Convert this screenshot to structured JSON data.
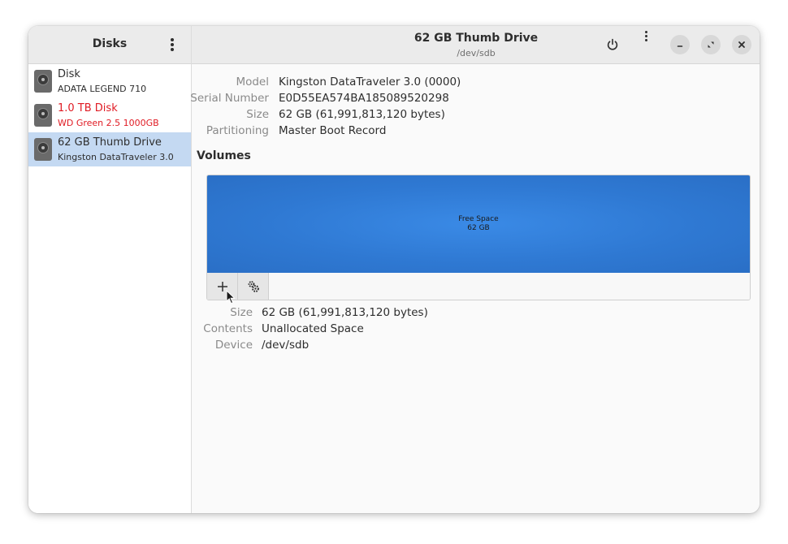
{
  "sidebar": {
    "title": "Disks",
    "disks": [
      {
        "name": "Disk",
        "model": "ADATA LEGEND 710"
      },
      {
        "name": "1.0 TB Disk",
        "model": "WD Green 2.5 1000GB"
      },
      {
        "name": "62 GB Thumb Drive",
        "model": "Kingston DataTraveler 3.0"
      }
    ]
  },
  "header": {
    "title": "62 GB Thumb Drive",
    "subtitle": "/dev/sdb"
  },
  "drive_info": {
    "model_label": "Model",
    "model_value": "Kingston DataTraveler 3.0 (0000)",
    "serial_label": "Serial Number",
    "serial_value": "E0D55EA574BA185089520298",
    "size_label": "Size",
    "size_value": "62 GB (61,991,813,120 bytes)",
    "partitioning_label": "Partitioning",
    "partitioning_value": "Master Boot Record"
  },
  "volumes": {
    "heading": "Volumes",
    "segment_name": "Free Space",
    "segment_size": "62 GB"
  },
  "volume_info": {
    "size_label": "Size",
    "size_value": "62 GB (61,991,813,120 bytes)",
    "contents_label": "Contents",
    "contents_value": "Unallocated Space",
    "device_label": "Device",
    "device_value": "/dev/sdb"
  },
  "colors": {
    "accent_selected": "#c4d9f2",
    "warning": "#e01b24",
    "volume_free_space": "#2f79d3"
  },
  "icons": [
    "disk-icon",
    "kebab-menu-icon",
    "power-icon",
    "minimize-icon",
    "maximize-icon",
    "close-icon",
    "plus-icon",
    "gears-icon",
    "mouse-pointer-icon"
  ]
}
